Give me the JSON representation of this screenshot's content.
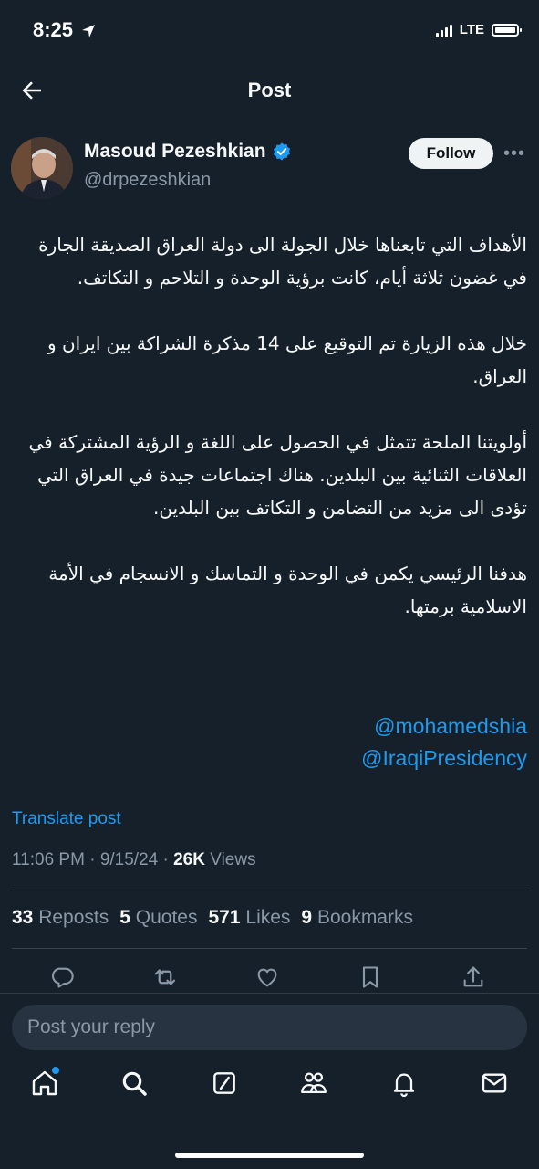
{
  "status_bar": {
    "time": "8:25",
    "network": "LTE"
  },
  "header": {
    "title": "Post"
  },
  "author": {
    "name": "Masoud Pezeshkian",
    "handle": "@drpezeshkian",
    "follow_label": "Follow",
    "verified": true
  },
  "post": {
    "paragraphs": [
      "الأهداف التي تابعناها خلال الجولة الى دولة العراق الصديقة الجارة في غضون ثلاثة أيام، كانت برؤية الوحدة و التلاحم و التكاتف.",
      "خلال هذه الزيارة تم التوقيع على 14 مذكرة الشراكة بين ايران و العراق.",
      "أولويتنا الملحة تتمثل في الحصول على اللغة و الرؤية المشتركة في العلاقات الثنائية بين البلدين. هناك اجتماعات جيدة في العراق التي تؤدى الى مزيد من التضامن و التكاتف بين البلدين.",
      "هدفنا الرئيسي يكمن في الوحدة و التماسك و الانسجام في الأمة الاسلامية برمتها."
    ],
    "mentions": [
      "@mohamedshia",
      "@IraqiPresidency"
    ],
    "translate_label": "Translate post",
    "time": "11:06 PM",
    "date": "9/15/24",
    "views_count": "26K",
    "views_label": "Views"
  },
  "stats": {
    "reposts_count": "33",
    "reposts_label": "Reposts",
    "quotes_count": "5",
    "quotes_label": "Quotes",
    "likes_count": "571",
    "likes_label": "Likes",
    "bookmarks_count": "9",
    "bookmarks_label": "Bookmarks"
  },
  "reply": {
    "placeholder": "Post your reply"
  },
  "icons": {
    "back": "back-arrow-icon",
    "actions": [
      "reply-icon",
      "repost-icon",
      "like-icon",
      "bookmark-icon",
      "share-icon"
    ],
    "tabs": [
      "home-icon",
      "search-icon",
      "grok-icon",
      "communities-icon",
      "notifications-icon",
      "messages-icon"
    ]
  },
  "colors": {
    "background": "#15202b",
    "accent": "#1d9bf0",
    "muted": "#8b98a5",
    "verified": "#1d9bf0"
  }
}
